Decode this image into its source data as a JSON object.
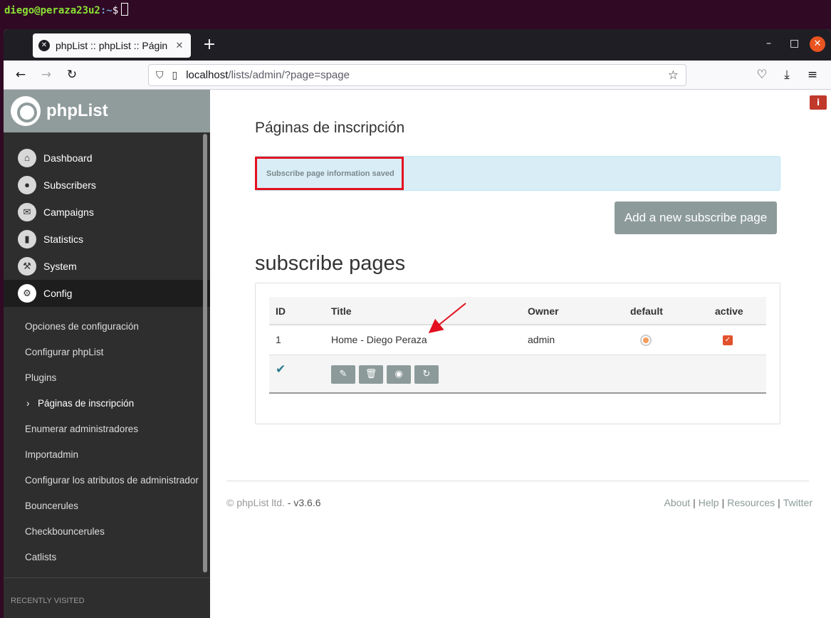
{
  "terminal": {
    "user_host": "diego@peraza23u2",
    "path": ":~",
    "prompt": "$"
  },
  "browser": {
    "tab_title": "phpList :: phpList :: Págin",
    "url_host": "localhost",
    "url_rest": "/lists/admin/?page=spage"
  },
  "sidebar": {
    "logo_text": "phpList",
    "menu": [
      {
        "label": "Dashboard",
        "icon": "home-icon"
      },
      {
        "label": "Subscribers",
        "icon": "user-icon"
      },
      {
        "label": "Campaigns",
        "icon": "envelope-icon"
      },
      {
        "label": "Statistics",
        "icon": "bar-chart-icon"
      },
      {
        "label": "System",
        "icon": "wrench-icon"
      },
      {
        "label": "Config",
        "icon": "gear-icon"
      }
    ],
    "submenu": [
      "Opciones de configuración",
      "Configurar phpList",
      "Plugins",
      "Páginas de inscripción",
      "Enumerar administradores",
      "Importadmin",
      "Configurar los atributos de administrador",
      "Bouncerules",
      "Checkbouncerules",
      "Catlists"
    ],
    "recent_label": "RECENTLY VISITED"
  },
  "main": {
    "page_title": "Páginas de inscripción",
    "alert": "Subscribe page information saved",
    "add_button": "Add a new subscribe page",
    "section_title": "subscribe pages",
    "table": {
      "headers": [
        "ID",
        "Title",
        "Owner",
        "default",
        "active"
      ],
      "rows": [
        {
          "id": "1",
          "title": "Home - Diego Peraza",
          "owner": "admin",
          "default": true,
          "active": true
        }
      ]
    },
    "action_icons": [
      "edit-icon",
      "trash-icon",
      "eye-icon",
      "refresh-icon"
    ]
  },
  "footer": {
    "copyright": "© phpList ltd.",
    "version": " - v3.6.6",
    "links": [
      "About",
      "Help",
      "Resources",
      "Twitter"
    ]
  },
  "colors": {
    "brand_gray": "#8c9b9a",
    "alert_bg": "#d9edf7",
    "highlight_red": "#e3101f",
    "sidebar_bg": "#2e2e2e",
    "firefox_close": "#e95420"
  }
}
